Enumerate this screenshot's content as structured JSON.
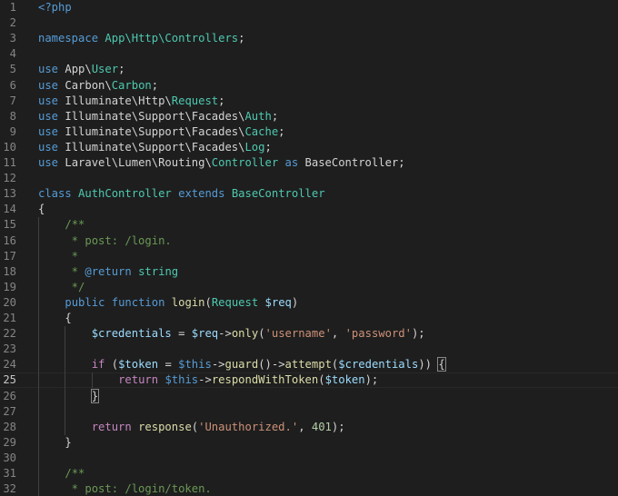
{
  "editor": {
    "language": "php",
    "current_line": 25,
    "lines": [
      {
        "n": "1",
        "tokens": [
          {
            "t": "<?php",
            "c": "k"
          }
        ]
      },
      {
        "n": "2",
        "tokens": []
      },
      {
        "n": "3",
        "tokens": [
          {
            "t": "namespace",
            "c": "k"
          },
          {
            "t": " ",
            "c": "p"
          },
          {
            "t": "App\\Http\\Controllers",
            "c": "t"
          },
          {
            "t": ";",
            "c": "p"
          }
        ]
      },
      {
        "n": "4",
        "tokens": []
      },
      {
        "n": "5",
        "tokens": [
          {
            "t": "use",
            "c": "k"
          },
          {
            "t": " App\\",
            "c": "p"
          },
          {
            "t": "User",
            "c": "t"
          },
          {
            "t": ";",
            "c": "p"
          }
        ]
      },
      {
        "n": "6",
        "tokens": [
          {
            "t": "use",
            "c": "k"
          },
          {
            "t": " Carbon\\",
            "c": "p"
          },
          {
            "t": "Carbon",
            "c": "t"
          },
          {
            "t": ";",
            "c": "p"
          }
        ]
      },
      {
        "n": "7",
        "tokens": [
          {
            "t": "use",
            "c": "k"
          },
          {
            "t": " Illuminate\\Http\\",
            "c": "p"
          },
          {
            "t": "Request",
            "c": "t"
          },
          {
            "t": ";",
            "c": "p"
          }
        ]
      },
      {
        "n": "8",
        "tokens": [
          {
            "t": "use",
            "c": "k"
          },
          {
            "t": " Illuminate\\Support\\Facades\\",
            "c": "p"
          },
          {
            "t": "Auth",
            "c": "t"
          },
          {
            "t": ";",
            "c": "p"
          }
        ]
      },
      {
        "n": "9",
        "tokens": [
          {
            "t": "use",
            "c": "k"
          },
          {
            "t": " Illuminate\\Support\\Facades\\",
            "c": "p"
          },
          {
            "t": "Cache",
            "c": "t"
          },
          {
            "t": ";",
            "c": "p"
          }
        ]
      },
      {
        "n": "10",
        "tokens": [
          {
            "t": "use",
            "c": "k"
          },
          {
            "t": " Illuminate\\Support\\Facades\\",
            "c": "p"
          },
          {
            "t": "Log",
            "c": "t"
          },
          {
            "t": ";",
            "c": "p"
          }
        ]
      },
      {
        "n": "11",
        "tokens": [
          {
            "t": "use",
            "c": "k"
          },
          {
            "t": " Laravel\\Lumen\\Routing\\",
            "c": "p"
          },
          {
            "t": "Controller",
            "c": "t"
          },
          {
            "t": " ",
            "c": "p"
          },
          {
            "t": "as",
            "c": "k"
          },
          {
            "t": " BaseController;",
            "c": "p"
          }
        ]
      },
      {
        "n": "12",
        "tokens": []
      },
      {
        "n": "13",
        "tokens": [
          {
            "t": "class",
            "c": "k"
          },
          {
            "t": " ",
            "c": "p"
          },
          {
            "t": "AuthController",
            "c": "t"
          },
          {
            "t": " ",
            "c": "p"
          },
          {
            "t": "extends",
            "c": "k"
          },
          {
            "t": " ",
            "c": "p"
          },
          {
            "t": "BaseController",
            "c": "t"
          }
        ]
      },
      {
        "n": "14",
        "tokens": [
          {
            "t": "{",
            "c": "p"
          }
        ]
      },
      {
        "n": "15",
        "tokens": [
          {
            "t": "    ",
            "c": "p"
          },
          {
            "t": "/**",
            "c": "cm"
          }
        ]
      },
      {
        "n": "16",
        "tokens": [
          {
            "t": "     * post: /login.",
            "c": "cm"
          }
        ]
      },
      {
        "n": "17",
        "tokens": [
          {
            "t": "     *",
            "c": "cm"
          }
        ]
      },
      {
        "n": "18",
        "tokens": [
          {
            "t": "     * ",
            "c": "cm"
          },
          {
            "t": "@return",
            "c": "dc"
          },
          {
            "t": " ",
            "c": "cm"
          },
          {
            "t": "string",
            "c": "t"
          }
        ]
      },
      {
        "n": "19",
        "tokens": [
          {
            "t": "     */",
            "c": "cm"
          }
        ]
      },
      {
        "n": "20",
        "tokens": [
          {
            "t": "    ",
            "c": "p"
          },
          {
            "t": "public",
            "c": "k"
          },
          {
            "t": " ",
            "c": "p"
          },
          {
            "t": "function",
            "c": "k"
          },
          {
            "t": " ",
            "c": "p"
          },
          {
            "t": "login",
            "c": "f"
          },
          {
            "t": "(",
            "c": "p"
          },
          {
            "t": "Request",
            "c": "t"
          },
          {
            "t": " ",
            "c": "p"
          },
          {
            "t": "$req",
            "c": "v"
          },
          {
            "t": ")",
            "c": "p"
          }
        ]
      },
      {
        "n": "21",
        "tokens": [
          {
            "t": "    {",
            "c": "p"
          }
        ]
      },
      {
        "n": "22",
        "tokens": [
          {
            "t": "        ",
            "c": "p"
          },
          {
            "t": "$credentials",
            "c": "v"
          },
          {
            "t": " = ",
            "c": "p"
          },
          {
            "t": "$req",
            "c": "v"
          },
          {
            "t": "->",
            "c": "p"
          },
          {
            "t": "only",
            "c": "f"
          },
          {
            "t": "(",
            "c": "p"
          },
          {
            "t": "'username'",
            "c": "s"
          },
          {
            "t": ", ",
            "c": "p"
          },
          {
            "t": "'password'",
            "c": "s"
          },
          {
            "t": ");",
            "c": "p"
          }
        ]
      },
      {
        "n": "23",
        "tokens": []
      },
      {
        "n": "24",
        "tokens": [
          {
            "t": "        ",
            "c": "p"
          },
          {
            "t": "if",
            "c": "c"
          },
          {
            "t": " (",
            "c": "p"
          },
          {
            "t": "$token",
            "c": "v"
          },
          {
            "t": " = ",
            "c": "p"
          },
          {
            "t": "$this",
            "c": "k"
          },
          {
            "t": "->",
            "c": "p"
          },
          {
            "t": "guard",
            "c": "f"
          },
          {
            "t": "()->",
            "c": "p"
          },
          {
            "t": "attempt",
            "c": "f"
          },
          {
            "t": "(",
            "c": "p"
          },
          {
            "t": "$credentials",
            "c": "v"
          },
          {
            "t": ")) ",
            "c": "p"
          },
          {
            "t": "{",
            "c": "p bm"
          }
        ]
      },
      {
        "n": "25",
        "tokens": [
          {
            "t": "            ",
            "c": "p"
          },
          {
            "t": "return",
            "c": "c"
          },
          {
            "t": " ",
            "c": "p"
          },
          {
            "t": "$this",
            "c": "k"
          },
          {
            "t": "->",
            "c": "p"
          },
          {
            "t": "respondWithToken",
            "c": "f"
          },
          {
            "t": "(",
            "c": "p"
          },
          {
            "t": "$token",
            "c": "v"
          },
          {
            "t": ");",
            "c": "p"
          }
        ]
      },
      {
        "n": "26",
        "tokens": [
          {
            "t": "        ",
            "c": "p"
          },
          {
            "t": "}",
            "c": "p bm"
          }
        ]
      },
      {
        "n": "27",
        "tokens": []
      },
      {
        "n": "28",
        "tokens": [
          {
            "t": "        ",
            "c": "p"
          },
          {
            "t": "return",
            "c": "c"
          },
          {
            "t": " ",
            "c": "p"
          },
          {
            "t": "response",
            "c": "f"
          },
          {
            "t": "(",
            "c": "p"
          },
          {
            "t": "'Unauthorized.'",
            "c": "s"
          },
          {
            "t": ", ",
            "c": "p"
          },
          {
            "t": "401",
            "c": "n"
          },
          {
            "t": ");",
            "c": "p"
          }
        ]
      },
      {
        "n": "29",
        "tokens": [
          {
            "t": "    }",
            "c": "p"
          }
        ]
      },
      {
        "n": "30",
        "tokens": []
      },
      {
        "n": "31",
        "tokens": [
          {
            "t": "    ",
            "c": "p"
          },
          {
            "t": "/**",
            "c": "cm"
          }
        ]
      },
      {
        "n": "32",
        "tokens": [
          {
            "t": "     * post: /login/token.",
            "c": "cm"
          }
        ]
      }
    ]
  }
}
